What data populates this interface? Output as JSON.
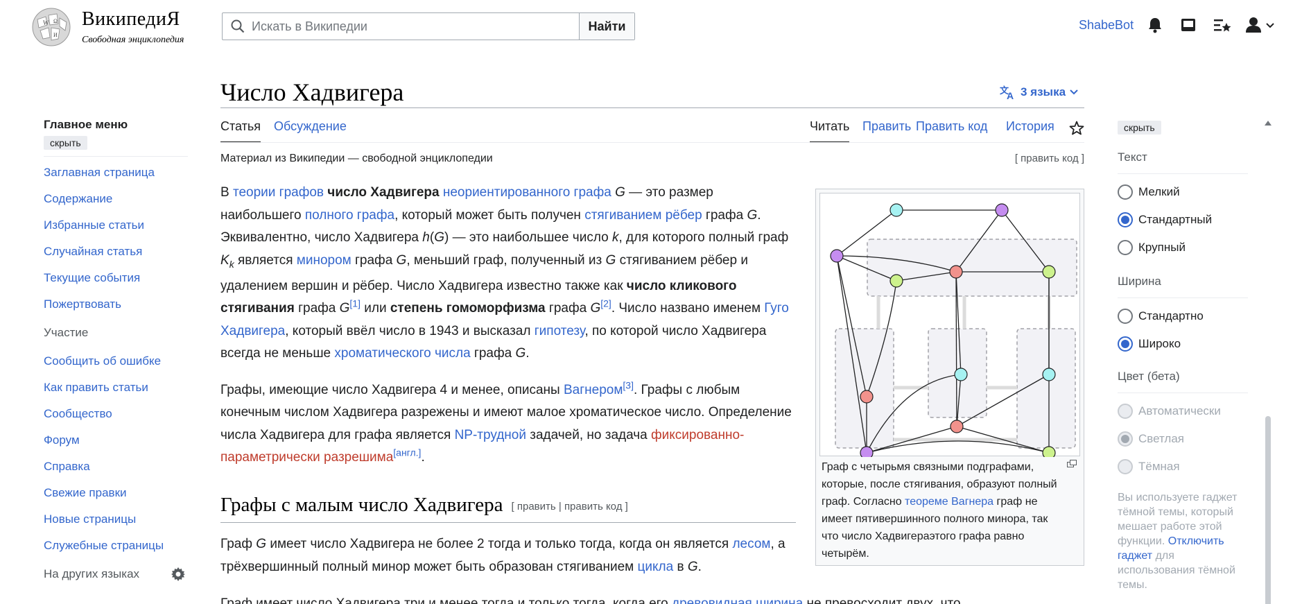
{
  "header": {
    "wordmark": "ВикипедиЯ",
    "tagline": "Свободная энциклопедия",
    "search_placeholder": "Искать в Википедии",
    "search_button": "Найти",
    "username": "ShabeBot"
  },
  "sidebar": {
    "menu_title": "Главное меню",
    "hide": "скрыть",
    "items": [
      "Заглавная страница",
      "Содержание",
      "Избранные статьи",
      "Случайная статья",
      "Текущие события",
      "Пожертвовать"
    ],
    "section": "Участие",
    "items2": [
      "Сообщить об ошибке",
      "Как править статьи",
      "Сообщество",
      "Форум",
      "Справка",
      "Свежие правки",
      "Новые страницы",
      "Служебные страницы"
    ],
    "other_langs": "На других языках"
  },
  "article": {
    "title": "Число Хадвигера",
    "languages": "3 языка",
    "tabs": {
      "article": "Статья",
      "talk": "Обсуждение",
      "read": "Читать",
      "edit": "Править",
      "edit_source": "Править код",
      "history": "История"
    },
    "from": "Материал из Википедии — свободной энциклопедии",
    "edit_code_link": "[ править код ]",
    "p1": {
      "a1": "В ",
      "l1": "теории графов",
      "b1": "число Хадвигера",
      "l2": "неориентированного графа",
      "t1": "G",
      "t2": " — это размер наибольшего ",
      "l3": "полного графа",
      "t3": ", который может быть получен ",
      "l4": "стягиванием рёбер",
      "t4": " графа ",
      "t5": "G",
      "t6": ". Эквивалентно, число Хадвигера ",
      "t7": "h",
      "t8": "(",
      "t9": "G",
      "t10": ") — это наибольшее число ",
      "t11": "k",
      "t12": ", для которого полный граф ",
      "t13": "K",
      "t14": "k",
      "t15": " является ",
      "l5": "минором",
      "t16": " графа ",
      "t17": "G",
      "t18": ", меньший граф, полученный из ",
      "t19": "G",
      "t20": " стягиванием рёбер и удалением вершин и рёбер. Число Хадвигера известно также как ",
      "b2": "число кликового стягивания",
      "t21": " графа ",
      "t22": "G",
      "s1": "[1]",
      "t23": " или ",
      "b3": "степень гомоморфизма",
      "t24": " графа ",
      "t25": "G",
      "s2": "[2]",
      "t26": ". Число названо именем ",
      "l6": "Гуго Хадвигера",
      "t27": ", который ввёл число в 1943 и высказал ",
      "l7": "гипотезу",
      "t28": ", по которой число Хадвигера всегда не меньше ",
      "l8": "хроматического числа",
      "t29": " графа ",
      "t30": "G",
      "t31": "."
    },
    "p2": {
      "t1": "Графы, имеющие число Хадвигера 4 и менее, описаны ",
      "l1": "Вагнером",
      "s1": "[3]",
      "t2": ". Графы с любым конечным числом Хадвигера разрежены и имеют малое хроматическое число. Определение числа Хадвигера для графа является ",
      "l2": "NP-трудной",
      "t3": " задачей, но задача ",
      "r1": "фиксированно-параметрически разрешима",
      "s2": "[англ.]",
      "t4": "."
    },
    "h2": "Графы с малым число Хадвигера",
    "h2_edit": "[ править | править код ]",
    "p3": {
      "t1": "Граф ",
      "t2": "G",
      "t3": " имеет число Хадвигера не более 2 тогда и только тогда, когда он является ",
      "l1": "лесом",
      "t4": ", а трёхвершинный полный минор может быть образован стягиванием ",
      "l2": "цикла",
      "t5": " в ",
      "t6": "G",
      "t7": "."
    },
    "p4": {
      "t1": "Граф имеет число Хадвигера три и менее тогда и только тогда, когда его ",
      "l1": "древовидная ширина",
      "t2": " не превосходит двух, что"
    },
    "caption": {
      "t1": "Граф с четырьмя связными подграфами, которые, после стягивания, образуют полный граф. Согласно ",
      "l1": "теореме Вагнера",
      "t2": " граф не имеет пятивершинного полного минора, так что число Хадвигераэтого графа равно четырём."
    }
  },
  "appearance": {
    "hide": "скрыть",
    "text_label": "Текст",
    "text_options": [
      "Мелкий",
      "Стандартный",
      "Крупный"
    ],
    "text_selected": "Стандартный",
    "width_label": "Ширина",
    "width_options": [
      "Стандартно",
      "Широко"
    ],
    "width_selected": "Широко",
    "color_label": "Цвет (бета)",
    "color_options": [
      "Автоматически",
      "Светлая",
      "Тёмная"
    ],
    "color_selected": "Светлая",
    "note_start": "Вы используете гаджет тёмной темы, который мешает работе этой функции. ",
    "note_link": "Отключить гаджет",
    "note_end": " для использования тёмной темы."
  },
  "colors": {
    "link": "#3366cc",
    "redlink": "#bf3c2c",
    "node_purple": "#c58df0",
    "node_cyan": "#a6f2f2",
    "node_green": "#cdf28d",
    "node_red": "#f2928c"
  }
}
